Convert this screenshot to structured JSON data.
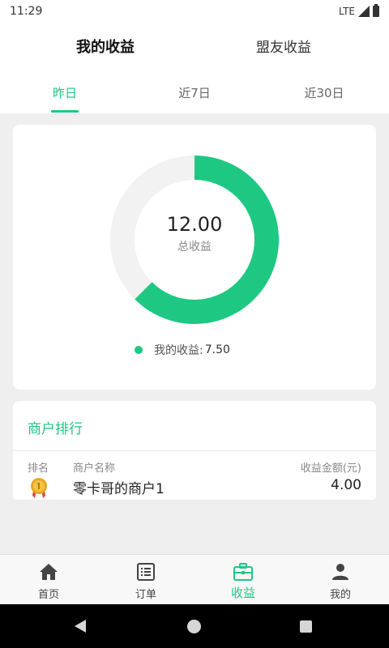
{
  "status_bar": {
    "time": "11:29",
    "network": "LTE"
  },
  "header": {
    "tabs": [
      {
        "label": "我的收益",
        "active": true
      },
      {
        "label": "盟友收益",
        "active": false
      }
    ]
  },
  "period_tabs": [
    {
      "label": "昨日",
      "active": true
    },
    {
      "label": "近7日",
      "active": false
    },
    {
      "label": "近30日",
      "active": false
    }
  ],
  "summary": {
    "total_value": "12.00",
    "total_label": "总收益",
    "my_label": "我的收益:",
    "my_value": "7.50",
    "my_fraction": 0.625
  },
  "ranking": {
    "title": "商户排行",
    "columns": {
      "rank": "排名",
      "name": "商户名称",
      "amount": "收益金额(元)"
    },
    "rows": [
      {
        "rank": 1,
        "name": "零卡哥的商户1",
        "amount": "4.00"
      }
    ]
  },
  "bottom_nav": [
    {
      "label": "首页",
      "icon": "home-icon",
      "active": false
    },
    {
      "label": "订单",
      "icon": "orders-icon",
      "active": false
    },
    {
      "label": "收益",
      "icon": "briefcase-icon",
      "active": true
    },
    {
      "label": "我的",
      "icon": "user-icon",
      "active": false
    }
  ],
  "colors": {
    "accent": "#1ec882",
    "ring_track": "#f2f2f2",
    "medal_gold": "#e8a626"
  }
}
